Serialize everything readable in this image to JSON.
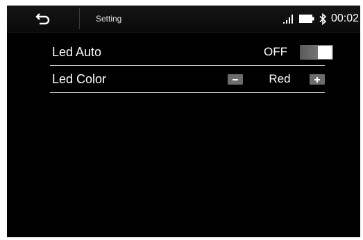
{
  "header": {
    "title": "Setting",
    "back_icon": "back-arrow-icon",
    "signal_icon": "signal-bars-icon",
    "battery_icon": "battery-icon",
    "bluetooth_icon": "bluetooth-icon",
    "time": "00:02"
  },
  "settings": {
    "led_auto": {
      "label": "Led Auto",
      "value": "OFF",
      "toggle_on": false
    },
    "led_color": {
      "label": "Led Color",
      "value": "Red",
      "decrement_icon": "minus-icon",
      "increment_icon": "plus-icon"
    }
  },
  "colors": {
    "background": "#000000",
    "text": "#ffffff",
    "divider": "#d0d0d0",
    "control_gray": "#6c6c6c"
  }
}
